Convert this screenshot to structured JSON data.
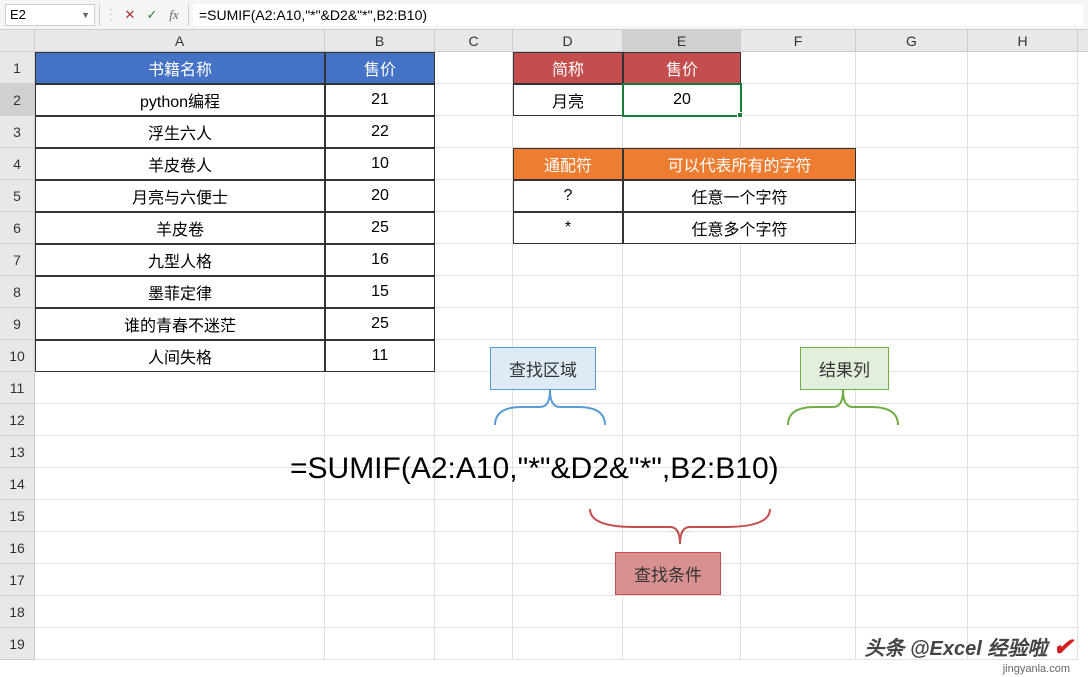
{
  "formula_bar": {
    "cell_ref": "E2",
    "formula": "=SUMIF(A2:A10,\"*\"&D2&\"*\",B2:B10)"
  },
  "columns": [
    "A",
    "B",
    "C",
    "D",
    "E",
    "F",
    "G",
    "H"
  ],
  "rows": [
    "1",
    "2",
    "3",
    "4",
    "5",
    "6",
    "7",
    "8",
    "9",
    "10",
    "11",
    "12",
    "13",
    "14",
    "15",
    "16",
    "17",
    "18",
    "19"
  ],
  "table1": {
    "headers": {
      "name": "书籍名称",
      "price": "售价"
    },
    "rows": [
      {
        "name": "python编程",
        "price": "21"
      },
      {
        "name": "浮生六人",
        "price": "22"
      },
      {
        "name": "羊皮卷人",
        "price": "10"
      },
      {
        "name": "月亮与六便士",
        "price": "20"
      },
      {
        "name": "羊皮卷",
        "price": "25"
      },
      {
        "name": "九型人格",
        "price": "16"
      },
      {
        "name": "墨菲定律",
        "price": "15"
      },
      {
        "name": "谁的青春不迷茫",
        "price": "25"
      },
      {
        "name": "人间失格",
        "price": "11"
      }
    ]
  },
  "table2": {
    "headers": {
      "short": "简称",
      "price": "售价"
    },
    "row": {
      "short": "月亮",
      "price": "20"
    }
  },
  "table3": {
    "headers": {
      "wild": "通配符",
      "desc": "可以代表所有的字符"
    },
    "rows": [
      {
        "wild": "?",
        "desc": "任意一个字符"
      },
      {
        "wild": "*",
        "desc": "任意多个字符"
      }
    ]
  },
  "annotations": {
    "range": "查找区域",
    "result": "结果列",
    "criteria": "查找条件",
    "formula": "=SUMIF(A2:A10,\"*\"&D2&\"*\",B2:B10)"
  },
  "watermark": {
    "main": "头条 @Excel 经验啦",
    "sub": "jingyanla.com",
    "check": "✔"
  }
}
